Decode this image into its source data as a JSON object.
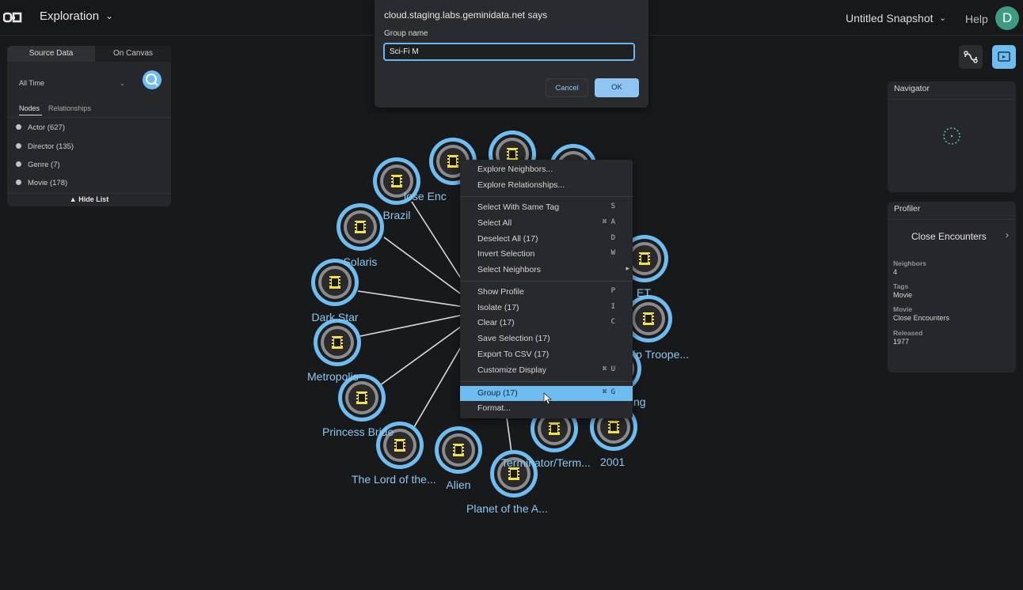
{
  "header": {
    "app_title": "Exploration",
    "snapshot_title": "Untitled Snapshot",
    "help_label": "Help",
    "avatar_initial": "D"
  },
  "left_panel": {
    "tabs": [
      {
        "label": "Source Data",
        "active": true
      },
      {
        "label": "On Canvas",
        "active": false
      }
    ],
    "time_filter": "All Time",
    "sub_tabs": [
      {
        "label": "Nodes",
        "active": true
      },
      {
        "label": "Relationships",
        "active": false
      }
    ],
    "node_types": [
      {
        "label": "Actor (627)"
      },
      {
        "label": "Director (135)"
      },
      {
        "label": "Genre (7)"
      },
      {
        "label": "Movie (178)"
      }
    ],
    "hide_list_label": "▲ Hide List"
  },
  "navigator": {
    "title": "Navigator"
  },
  "profiler": {
    "title": "Profiler",
    "name": "Close Encounters",
    "fields": [
      {
        "label": "Neighbors",
        "value": "4"
      },
      {
        "label": "Tags",
        "value": "Movie"
      },
      {
        "label": "Movie",
        "value": "Close Encounters"
      },
      {
        "label": "Released",
        "value": "1977"
      }
    ]
  },
  "graph": {
    "node_labels": {
      "close_enc": "lose Enc",
      "brazil": "Brazil",
      "solaris": "Solaris",
      "dark_star": "Dark Star",
      "metropolis": "Metropolis",
      "princess_bride": "Princess Bride",
      "lord_of_rings": "The Lord of the...",
      "alien": "Alien",
      "planet_apes": "Planet of the A...",
      "terminator": "Terminator/Term...",
      "odyssey_2001": "2001",
      "starship": "ip Troope...",
      "et": "ET",
      "ng": "ng"
    }
  },
  "context_menu": {
    "items": [
      {
        "label": "Explore Neighbors...",
        "shortcut": ""
      },
      {
        "label": "Explore Relationships...",
        "shortcut": ""
      },
      {
        "label": "Select With Same Tag",
        "shortcut": "S"
      },
      {
        "label": "Select All",
        "shortcut": "⌘ A"
      },
      {
        "label": "Deselect All (17)",
        "shortcut": "D"
      },
      {
        "label": "Invert Selection",
        "shortcut": "W"
      },
      {
        "label": "Select Neighbors",
        "shortcut": "▸"
      },
      {
        "label": "Show Profile",
        "shortcut": "P"
      },
      {
        "label": "Isolate (17)",
        "shortcut": "I"
      },
      {
        "label": "Clear (17)",
        "shortcut": "C"
      },
      {
        "label": "Save Selection (17)",
        "shortcut": ""
      },
      {
        "label": "Export To CSV (17)",
        "shortcut": ""
      },
      {
        "label": "Customize Display",
        "shortcut": "⌘ U"
      },
      {
        "label": "Group (17)",
        "shortcut": "⌘ G"
      },
      {
        "label": "Format...",
        "shortcut": ""
      }
    ]
  },
  "dialog": {
    "title": "cloud.staging.labs.geminidata.net says",
    "field_label": "Group name",
    "input_value": "Sci-Fi M",
    "cancel_label": "Cancel",
    "ok_label": "OK"
  },
  "colors": {
    "accent": "#6fbcf0",
    "node_ring": "#6fbcf0",
    "node_icon": "#f2e14a",
    "background": "#18191b"
  }
}
